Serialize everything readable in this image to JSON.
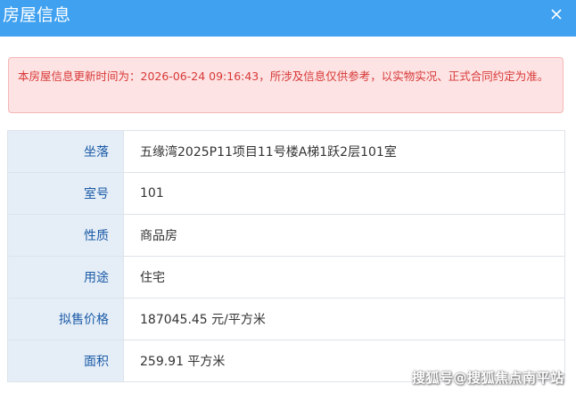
{
  "dialog": {
    "title": "房屋信息",
    "close_icon": "close-icon"
  },
  "notice": {
    "text": "本房屋信息更新时间为：2026-06-24 09:16:43，所涉及信息仅供参考，以实物实况、正式合同约定为准。",
    "color": "#d83838",
    "background": "#fde3e3"
  },
  "rows": [
    {
      "label": "坐落",
      "value": "五缘湾2025P11项目11号楼A梯1跃2层101室"
    },
    {
      "label": "室号",
      "value": "101"
    },
    {
      "label": "性质",
      "value": "商品房"
    },
    {
      "label": "用途",
      "value": "住宅"
    },
    {
      "label": "拟售价格",
      "value": "187045.45 元/平方米"
    },
    {
      "label": "面积",
      "value": "259.91 平方米"
    }
  ],
  "watermark": "搜狐号@搜狐焦点南平站",
  "colors": {
    "header": "#3fa1f0",
    "label_bg": "#e5eef7",
    "label_text": "#1b5aa6"
  }
}
